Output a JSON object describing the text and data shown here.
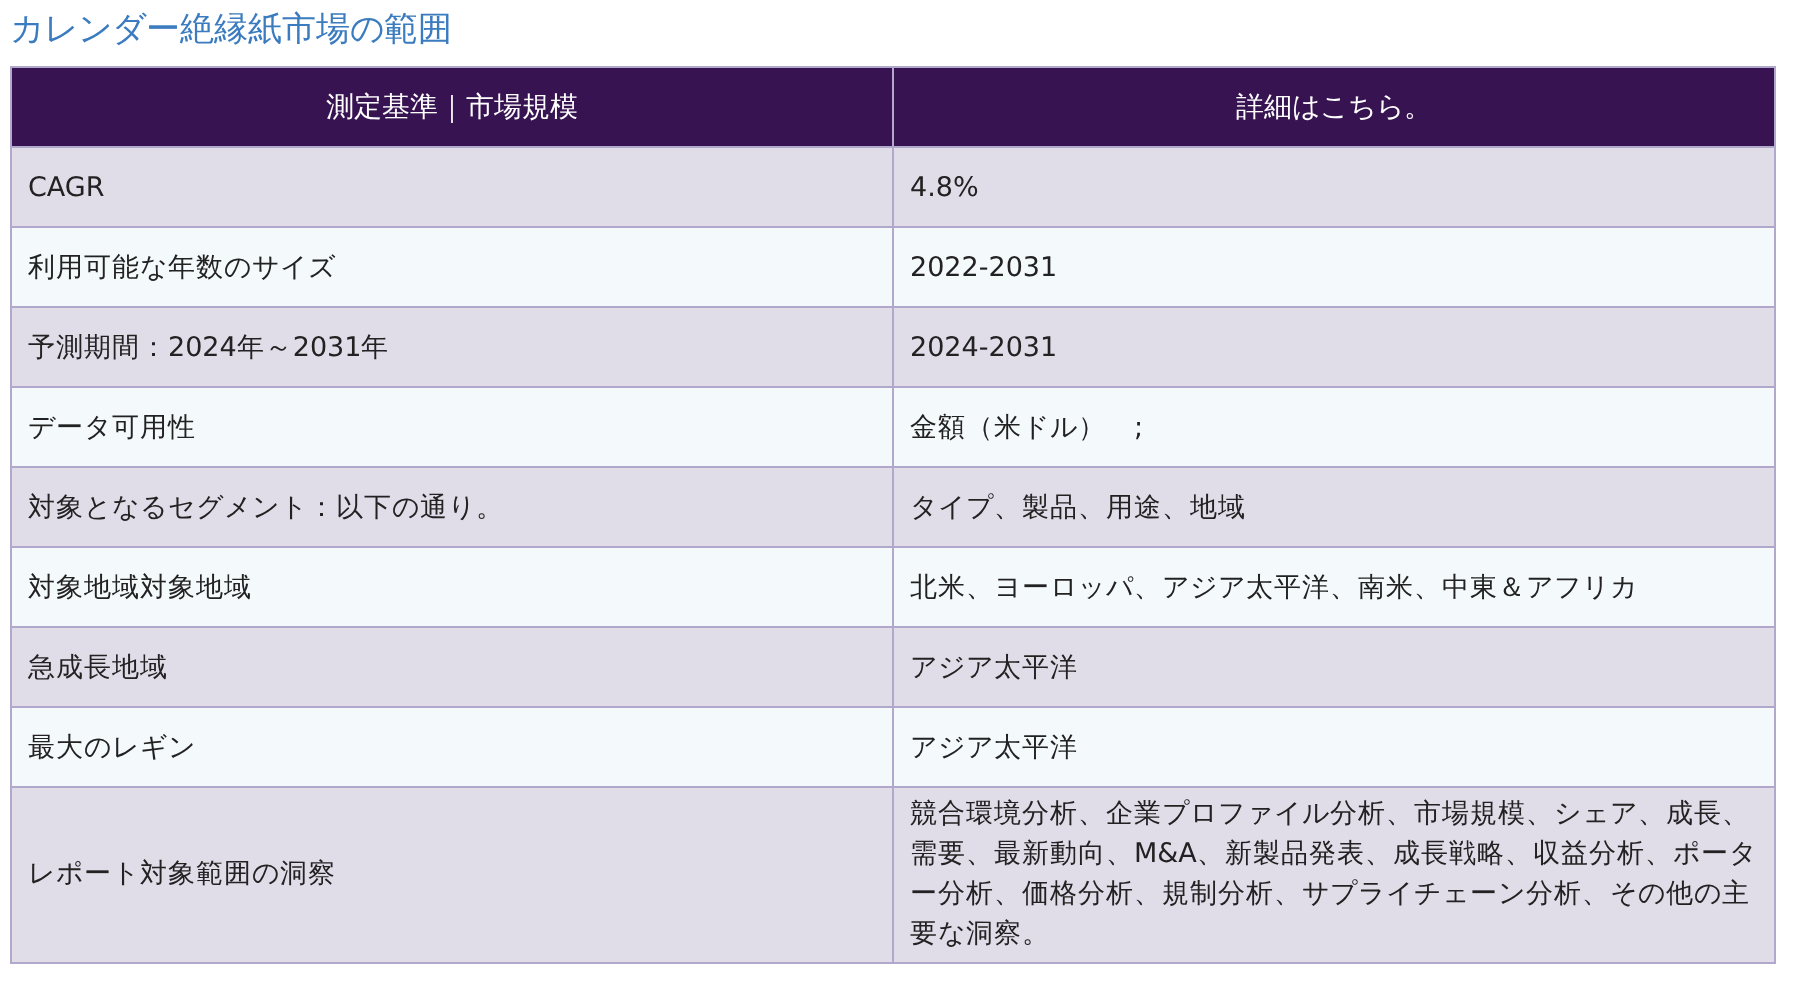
{
  "title": "カレンダー絶縁紙市場の範囲",
  "table": {
    "columns": [
      "測定基準｜市場規模",
      "詳細はこちら。"
    ],
    "rows": [
      [
        "CAGR",
        "4.8%"
      ],
      [
        "利用可能な年数のサイズ",
        "2022-2031"
      ],
      [
        "予測期間：2024年～2031年",
        "2024-2031"
      ],
      [
        "データ可用性",
        "金額（米ドル）　;"
      ],
      [
        "対象となるセグメント：以下の通り。",
        "タイプ、製品、用途、地域"
      ],
      [
        "対象地域対象地域",
        "北米、ヨーロッパ、アジア太平洋、南米、中東＆アフリカ"
      ],
      [
        "急成長地域",
        "アジア太平洋"
      ],
      [
        "最大のレギン",
        "アジア太平洋"
      ],
      [
        "レポート対象範囲の洞察",
        "競合環境分析、企業プロファイル分析、市場規模、シェア、成長、需要、最新動向、M&A、新製品発表、成長戦略、収益分析、ポーター分析、価格分析、規制分析、サプライチェーン分析、その他の主要な洞察。"
      ]
    ]
  }
}
